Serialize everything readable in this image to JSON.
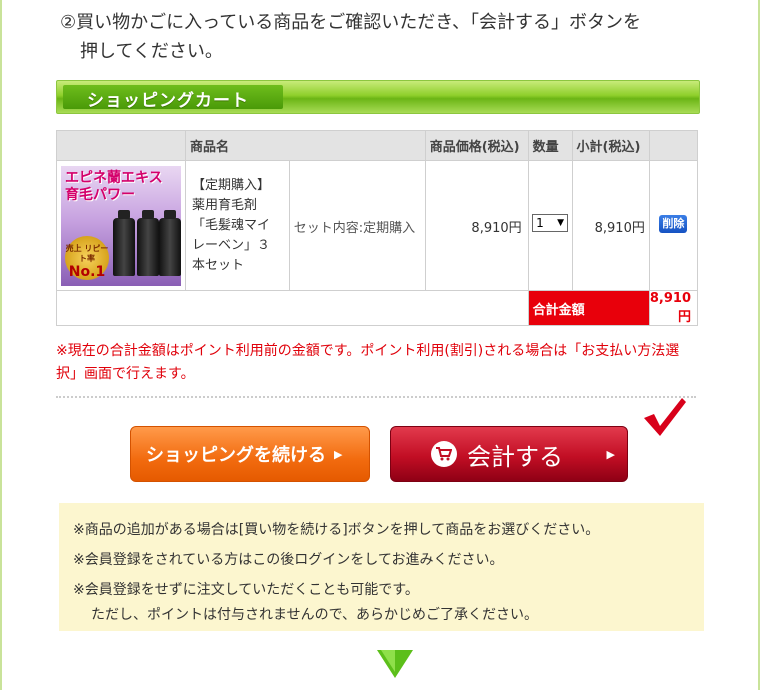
{
  "step": {
    "line1": "②買い物かごに入っている商品をご確認いただき、「会計する」ボタンを",
    "line2": "押してください。"
  },
  "cart_header": {
    "title": "ショッピングカート"
  },
  "table": {
    "headers": {
      "name": "商品名",
      "price": "商品価格(税込)",
      "qty": "数量",
      "subtotal": "小計(税込)"
    },
    "item": {
      "image_title_1": "エピネ蘭エキス",
      "image_title_2": "育毛パワー",
      "image_badge_small": "売上 リピート率",
      "image_badge_big": "No.1",
      "name": "【定期購入】薬用育毛剤「毛髪魂マイレーベン」３本セット",
      "set": "セット内容:定期購入",
      "price": "8,910円",
      "qty": "1",
      "subtotal": "8,910円",
      "delete_label": "削除"
    },
    "total": {
      "label": "合計金額",
      "value": "8,910円"
    }
  },
  "notice": "※現在の合計金額はポイント利用前の金額です。ポイント利用(割引)される場合は「お支払い方法選択」画面で行えます。",
  "buttons": {
    "continue": "ショッピングを続ける",
    "checkout": "会計する",
    "arrow": "▶"
  },
  "info": {
    "line1": "※商品の追加がある場合は[買い物を続ける]ボタンを押して商品をお選びください。",
    "line2": "※会員登録をされている方はこの後ログインをしてお進みください。",
    "line3": "※会員登録をせずに注文していただくことも可能です。",
    "line3_sub": "ただし、ポイントは付与されませんので、あらかじめご了承ください。"
  },
  "colors": {
    "accent_green": "#6bb515",
    "total_red": "#e8000b",
    "checkout_red": "#c20e24",
    "continue_orange": "#f26b0f"
  }
}
